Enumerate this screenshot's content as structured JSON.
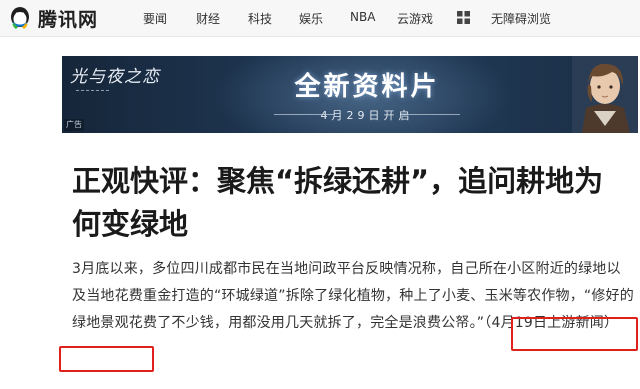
{
  "header": {
    "logo_text": "腾讯网",
    "nav": [
      "要闻",
      "财经",
      "科技",
      "娱乐",
      "NBA",
      "云游戏"
    ],
    "accessibility_label": "无障碍浏览"
  },
  "ad": {
    "game_logo": "光与夜之恋",
    "headline": "全新资料片",
    "date": "4月29日开启",
    "tag": "广告"
  },
  "article": {
    "title": "正观快评：聚焦“拆绿还耕”，追问耕地为何变绿地",
    "paragraph_main": "3月底以来，多位四川成都市民在当地问政平台反映情况称，自己所在小区附近的绿地以及当地花费重金打造的“环城绿道”拆除了绿化植物，种上了小麦、玉米等农作物，“修好的绿地景观花费了不少钱，用都没用几天就拆了，完全是浪费公帑。”",
    "source_note": "（4月19日上游新闻）"
  },
  "colors": {
    "annotation": "#e0201b",
    "logo_blue": "#1479d7",
    "logo_green": "#33b14a",
    "logo_yellow": "#f4b400"
  }
}
